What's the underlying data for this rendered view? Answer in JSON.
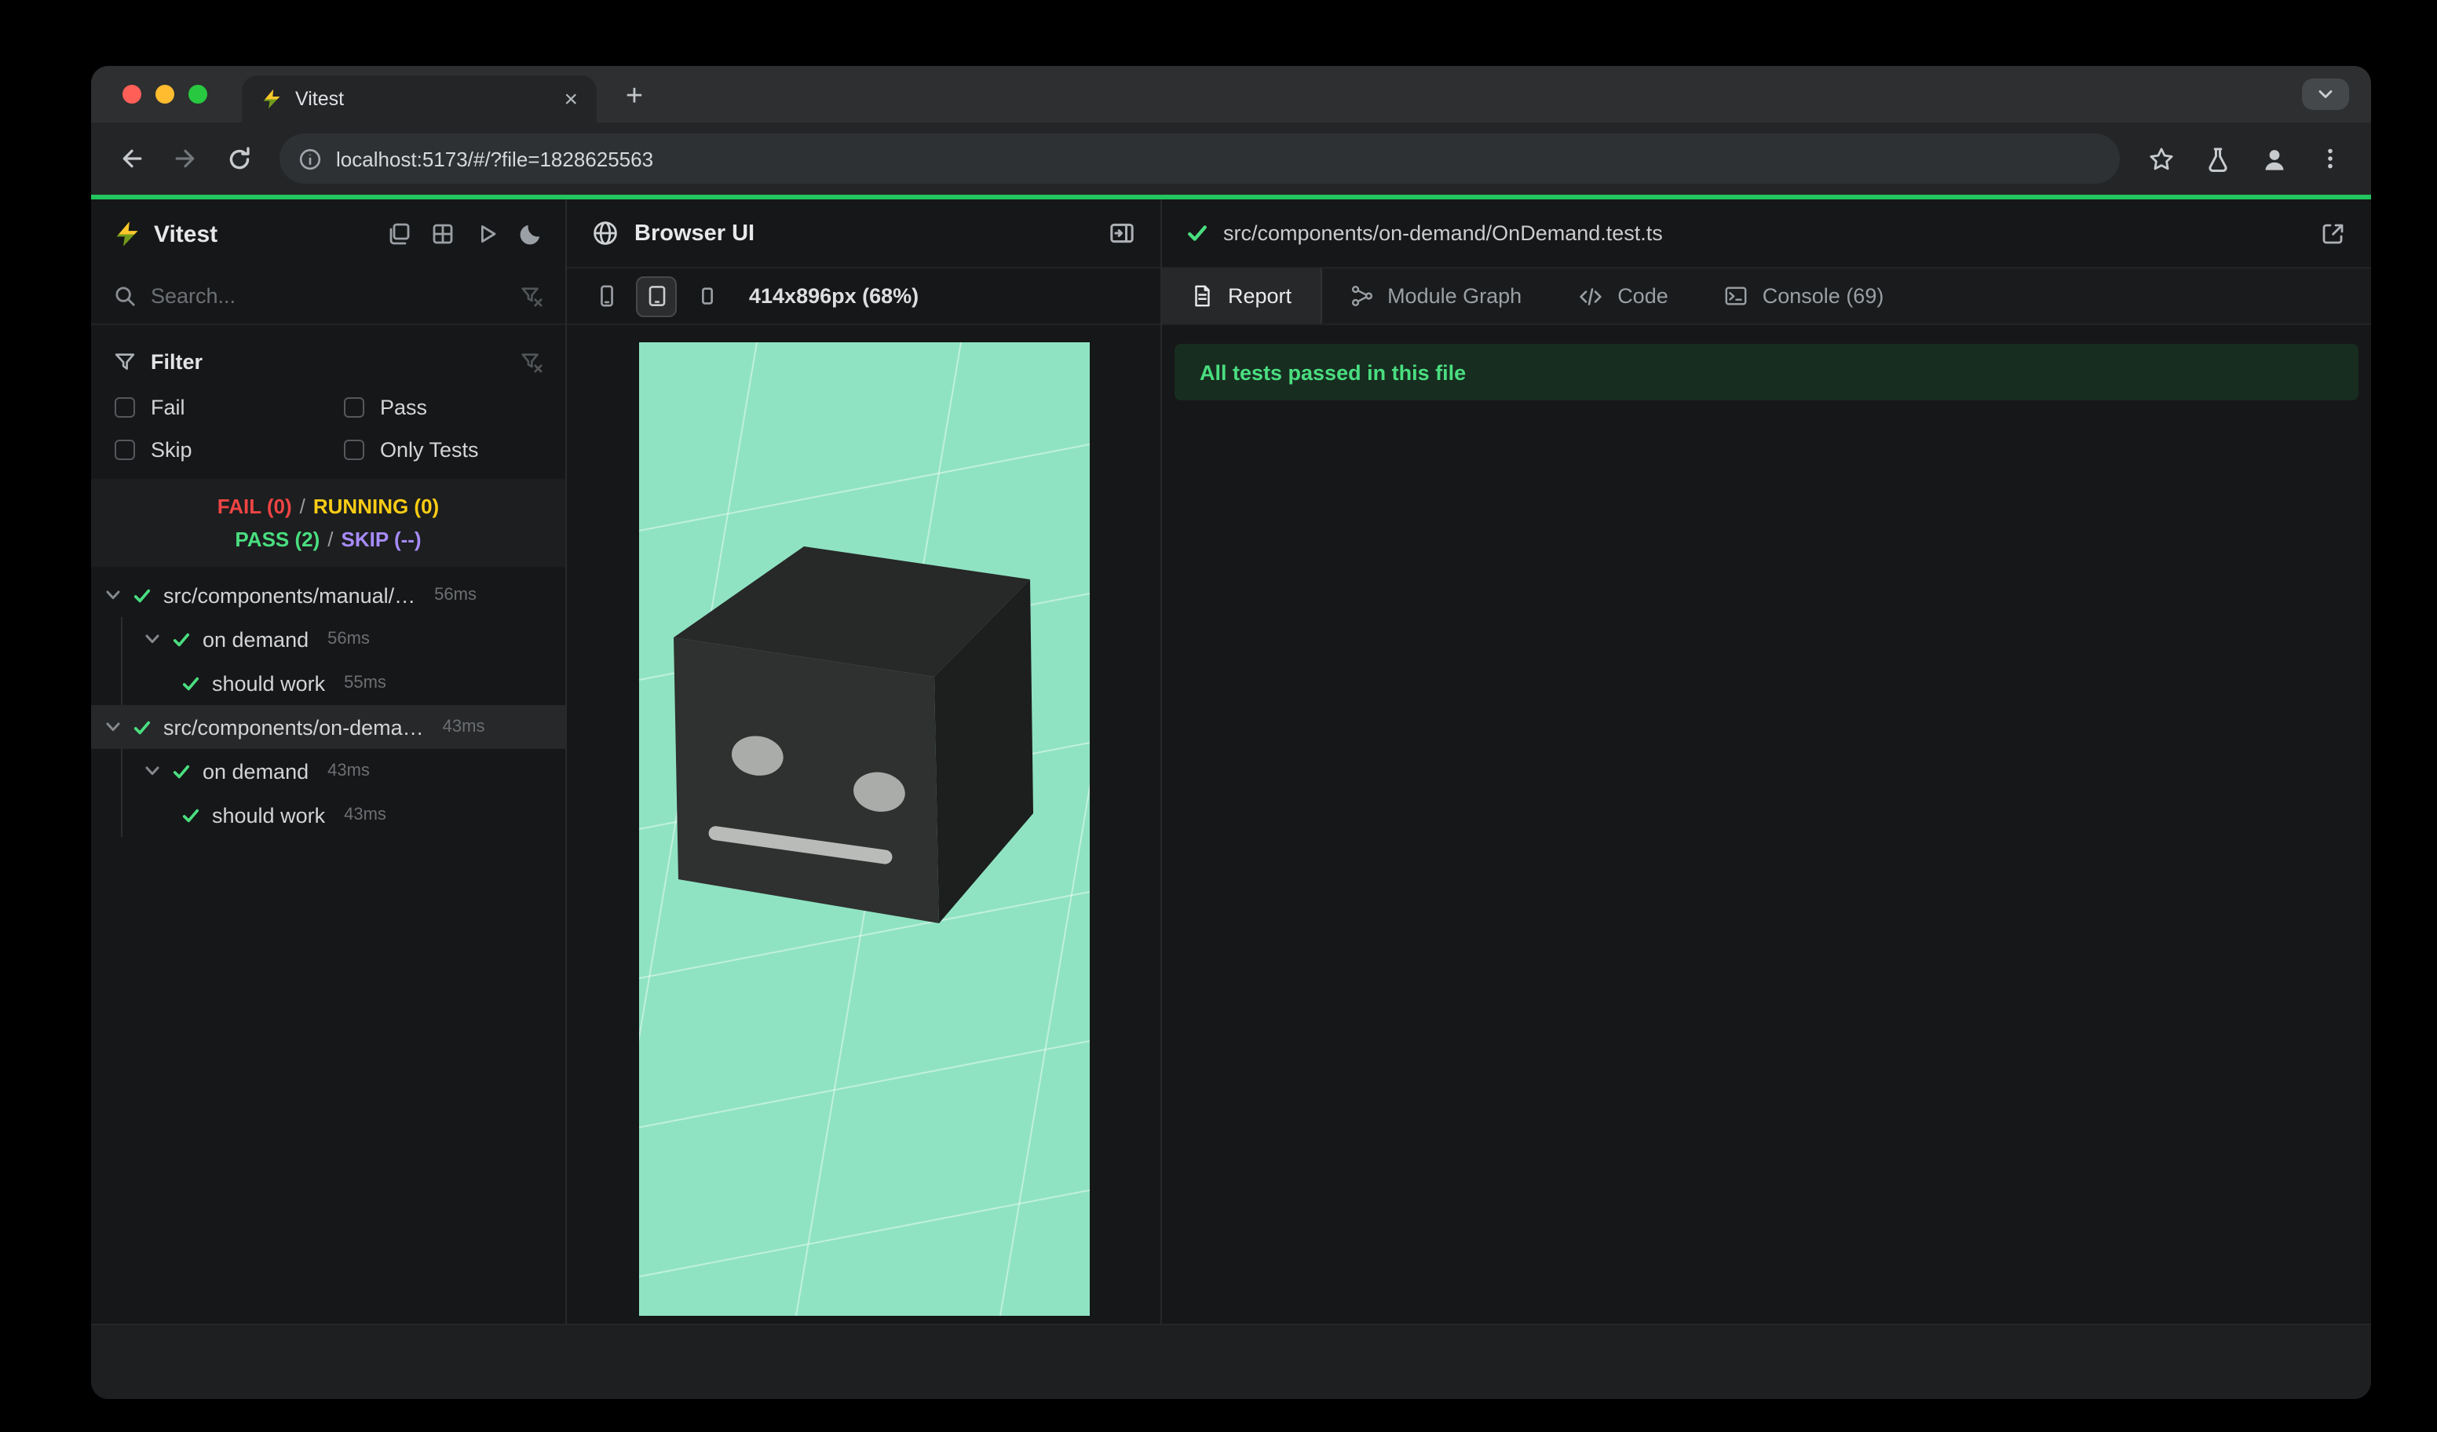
{
  "colors": {
    "accent": "#22c55e",
    "fail": "#ef4444",
    "running": "#facc15",
    "pass": "#4ade80",
    "skip": "#a78bfa",
    "canvas": "#8fe3c3"
  },
  "browser": {
    "tab_title": "Vitest",
    "url": "localhost:5173/#/?file=1828625563",
    "glyphs": {
      "close": "×",
      "new_tab": "+"
    }
  },
  "sidebar": {
    "app_title": "Vitest",
    "search_placeholder": "Search...",
    "filter_title": "Filter",
    "filter_options": [
      "Fail",
      "Pass",
      "Skip",
      "Only Tests"
    ],
    "status": {
      "fail": "FAIL (0)",
      "running": "RUNNING (0)",
      "pass": "PASS (2)",
      "skip": "SKIP (--)",
      "sep": "/"
    },
    "tree": [
      {
        "label": "src/components/manual/…",
        "time": "56ms"
      },
      {
        "label": "on demand",
        "time": "56ms"
      },
      {
        "label": "should work",
        "time": "55ms"
      },
      {
        "label": "src/components/on-dema…",
        "time": "43ms"
      },
      {
        "label": "on demand",
        "time": "43ms"
      },
      {
        "label": "should work",
        "time": "43ms"
      }
    ]
  },
  "browser_panel": {
    "title": "Browser UI",
    "viewport": "414x896px (68%)"
  },
  "report_panel": {
    "file": "src/components/on-demand/OnDemand.test.ts",
    "tabs": {
      "report": "Report",
      "module_graph": "Module Graph",
      "code": "Code",
      "console": "Console (69)"
    },
    "banner": "All tests passed in this file"
  }
}
